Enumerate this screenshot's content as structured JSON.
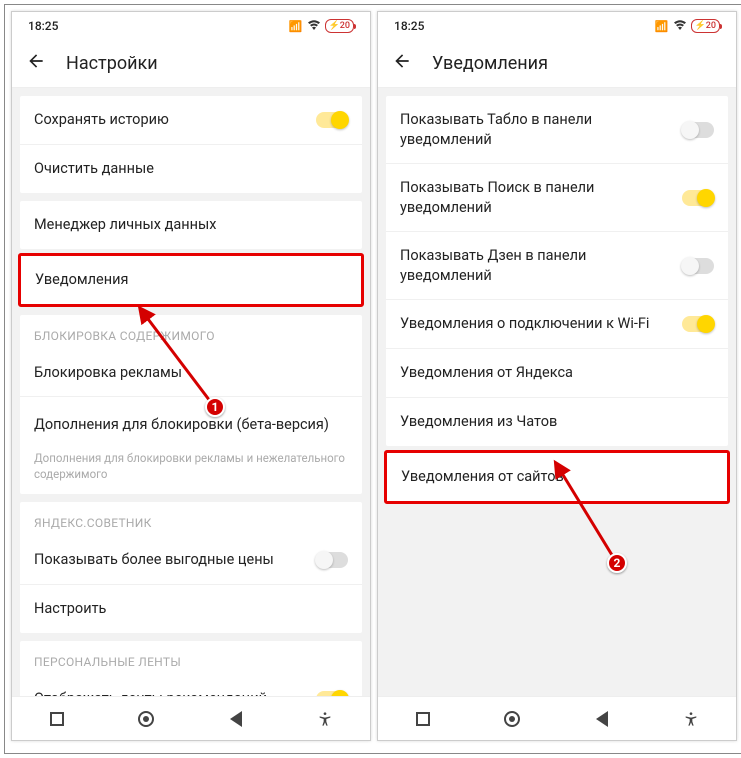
{
  "left": {
    "time": "18:25",
    "battery": "20",
    "title": "Настройки",
    "save_history": "Сохранять историю",
    "clear_data": "Очистить данные",
    "personal_data": "Менеджер личных данных",
    "notifications": "Уведомления",
    "section_block": "БЛОКИРОВКА СОДЕРЖИМОГО",
    "ad_block": "Блокировка рекламы",
    "addons": "Дополнения для блокировки (бета-версия)",
    "addons_help": "Дополнения для блокировки рекламы и нежелательного содержимого",
    "section_advisor": "ЯНДЕКС.СОВЕТНИК",
    "show_prices": "Показывать более выгодные цены",
    "configure": "Настроить",
    "section_feeds": "ПЕРСОНАЛЬНЫЕ ЛЕНТЫ",
    "show_feeds": "Отображать ленты рекомендаций"
  },
  "right": {
    "time": "18:25",
    "battery": "20",
    "title": "Уведомления",
    "tablo": "Показывать Табло в панели уведомлений",
    "search": "Показывать Поиск в панели уведомлений",
    "zen": "Показывать Дзен в панели уведомлений",
    "wifi": "Уведомления о подключении к Wi-Fi",
    "yandex": "Уведомления от Яндекса",
    "chats": "Уведомления из Чатов",
    "sites": "Уведомления от сайтов"
  }
}
